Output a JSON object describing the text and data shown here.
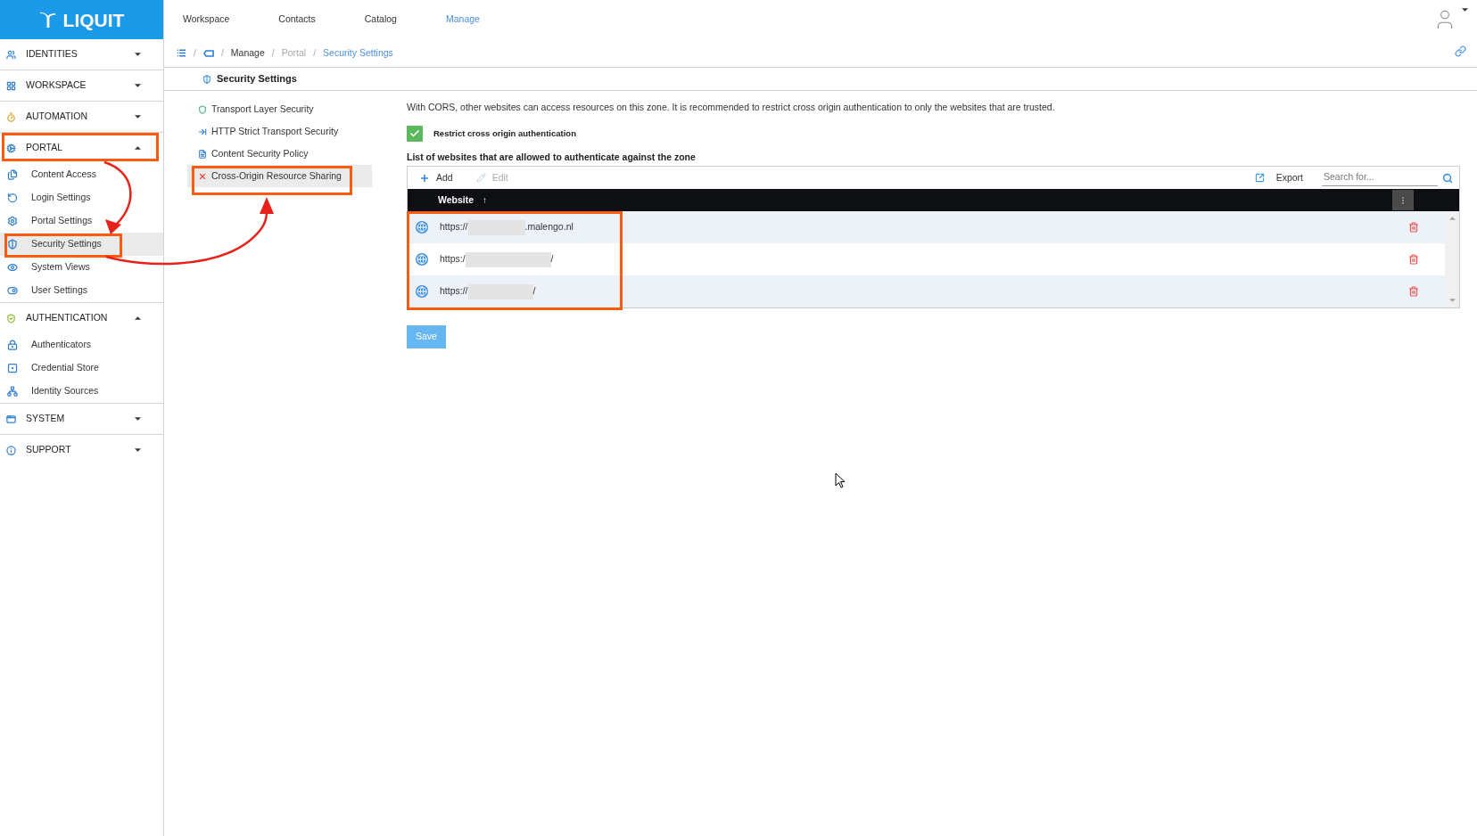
{
  "sidebar": {
    "logo": "LIQUIT",
    "sections": [
      {
        "label": "IDENTITIES",
        "expanded": false,
        "highlighted": false
      },
      {
        "label": "WORKSPACE",
        "expanded": false,
        "highlighted": false
      },
      {
        "label": "AUTOMATION",
        "expanded": false,
        "highlighted": false
      },
      {
        "label": "PORTAL",
        "expanded": true,
        "highlighted": true,
        "items": [
          {
            "label": "Content Access",
            "selected": false,
            "highlighted": false
          },
          {
            "label": "Login Settings",
            "selected": false,
            "highlighted": false
          },
          {
            "label": "Portal Settings",
            "selected": false,
            "highlighted": false
          },
          {
            "label": "Security Settings",
            "selected": true,
            "highlighted": true
          },
          {
            "label": "System Views",
            "selected": false,
            "highlighted": false
          },
          {
            "label": "User Settings",
            "selected": false,
            "highlighted": false
          }
        ]
      },
      {
        "label": "AUTHENTICATION",
        "expanded": true,
        "highlighted": false,
        "items": [
          {
            "label": "Authenticators",
            "selected": false,
            "highlighted": false
          },
          {
            "label": "Credential Store",
            "selected": false,
            "highlighted": false
          },
          {
            "label": "Identity Sources",
            "selected": false,
            "highlighted": false
          }
        ]
      },
      {
        "label": "SYSTEM",
        "expanded": false,
        "highlighted": false
      },
      {
        "label": "SUPPORT",
        "expanded": false,
        "highlighted": false
      }
    ]
  },
  "top_nav": {
    "items": [
      {
        "label": "Workspace",
        "selected": false
      },
      {
        "label": "Contacts",
        "selected": false
      },
      {
        "label": "Catalog",
        "selected": false
      },
      {
        "label": "Manage",
        "selected": true
      }
    ]
  },
  "breadcrumb": {
    "crumbs": [
      {
        "kind": "icon"
      },
      {
        "kind": "icon",
        "separator": "/"
      },
      {
        "kind": "link",
        "label": "Manage",
        "separator": "/"
      },
      {
        "kind": "muted",
        "label": "Portal",
        "separator": "/"
      },
      {
        "kind": "current",
        "label": "Security Settings",
        "separator": "/"
      }
    ]
  },
  "page_title": "Security Settings",
  "submenu": {
    "items": [
      {
        "label": "Transport Layer Security",
        "selected": false,
        "highlighted": false
      },
      {
        "label": "HTTP Strict Transport Security",
        "selected": false,
        "highlighted": false
      },
      {
        "label": "Content Security Policy",
        "selected": false,
        "highlighted": false
      },
      {
        "label": "Cross-Origin Resource Sharing",
        "selected": true,
        "highlighted": true
      }
    ]
  },
  "content": {
    "description": "With CORS, other websites can access resources on this zone. It is recommended to restrict cross origin authentication to only the websites that are trusted.",
    "restrict_checkbox": {
      "label": "Restrict cross origin authentication",
      "checked": true
    },
    "list_heading": "List of websites that are allowed to authenticate against the zone",
    "table": {
      "toolbar": {
        "add": {
          "label": "Add",
          "disabled": false
        },
        "edit": {
          "label": "Edit",
          "disabled": true
        },
        "export": {
          "label": "Export"
        },
        "search": {
          "placeholder": "Search for..."
        }
      },
      "columns": [
        {
          "label": "Website",
          "sort_mark": "↑"
        }
      ],
      "highlight_websites": true,
      "rows": [
        {
          "website_prefix": "https://",
          "redacted": true,
          "website_suffix": ".malengo.nl"
        },
        {
          "website_prefix": "https:/",
          "redacted": true,
          "website_suffix": "/"
        },
        {
          "website_prefix": "https://",
          "redacted": true,
          "website_suffix": "/"
        }
      ]
    },
    "save_button": {
      "label": "Save"
    }
  }
}
